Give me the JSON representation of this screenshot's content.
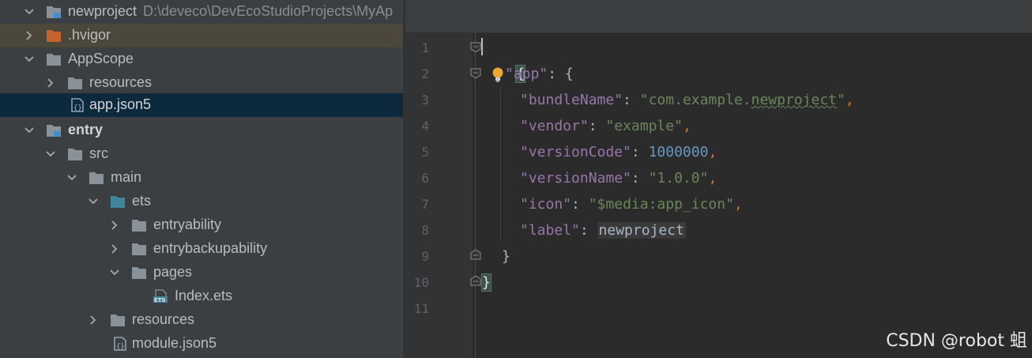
{
  "project_tree": {
    "root": {
      "name": "newproject",
      "path": "D:\\deveco\\DevEcoStudioProjects\\MyAp"
    },
    "items": [
      {
        "label": ".hvigor"
      },
      {
        "label": "AppScope"
      },
      {
        "label": "resources"
      },
      {
        "label": "app.json5"
      },
      {
        "label": "entry"
      },
      {
        "label": "src"
      },
      {
        "label": "main"
      },
      {
        "label": "ets"
      },
      {
        "label": "entryability"
      },
      {
        "label": "entrybackupability"
      },
      {
        "label": "pages"
      },
      {
        "label": "Index.ets"
      },
      {
        "label": "resources"
      },
      {
        "label": "module.json5"
      }
    ],
    "file_icon_text": {
      "json": "{}",
      "ets": "ETS"
    }
  },
  "editor": {
    "line_numbers": [
      "1",
      "2",
      "3",
      "4",
      "5",
      "6",
      "7",
      "8",
      "9",
      "10",
      "11"
    ],
    "code": {
      "open_brace": "{",
      "app_key": "\"app\"",
      "app_colon": ": {",
      "bundle_key": "\"bundleName\"",
      "bundle_sep": ": ",
      "bundle_val_a": "\"com.example.",
      "bundle_val_b": "newproject",
      "bundle_val_c": "\"",
      "bundle_comma": ",",
      "vendor_key": "\"vendor\"",
      "vendor_sep": ": ",
      "vendor_val": "\"example\"",
      "vendor_comma": ",",
      "vcode_key": "\"versionCode\"",
      "vcode_sep": ": ",
      "vcode_val": "1000000",
      "vcode_comma": ",",
      "vname_key": "\"versionName\"",
      "vname_sep": ": ",
      "vname_val": "\"1.0.0\"",
      "vname_comma": ",",
      "icon_key": "\"icon\"",
      "icon_sep": ": ",
      "icon_val": "\"$media:app_icon\"",
      "icon_comma": ",",
      "label_key": "\"label\"",
      "label_sep": ": ",
      "label_val": "newproject",
      "inner_close": "}",
      "outer_close": "}"
    }
  },
  "watermark": "CSDN @robot 蛆",
  "colors": {
    "tree_bg": "#3c3f41",
    "editor_bg": "#2b2b2b",
    "selected_row": "#0d293e",
    "key": "#9876aa",
    "string": "#6a8759",
    "number": "#6897bb"
  }
}
